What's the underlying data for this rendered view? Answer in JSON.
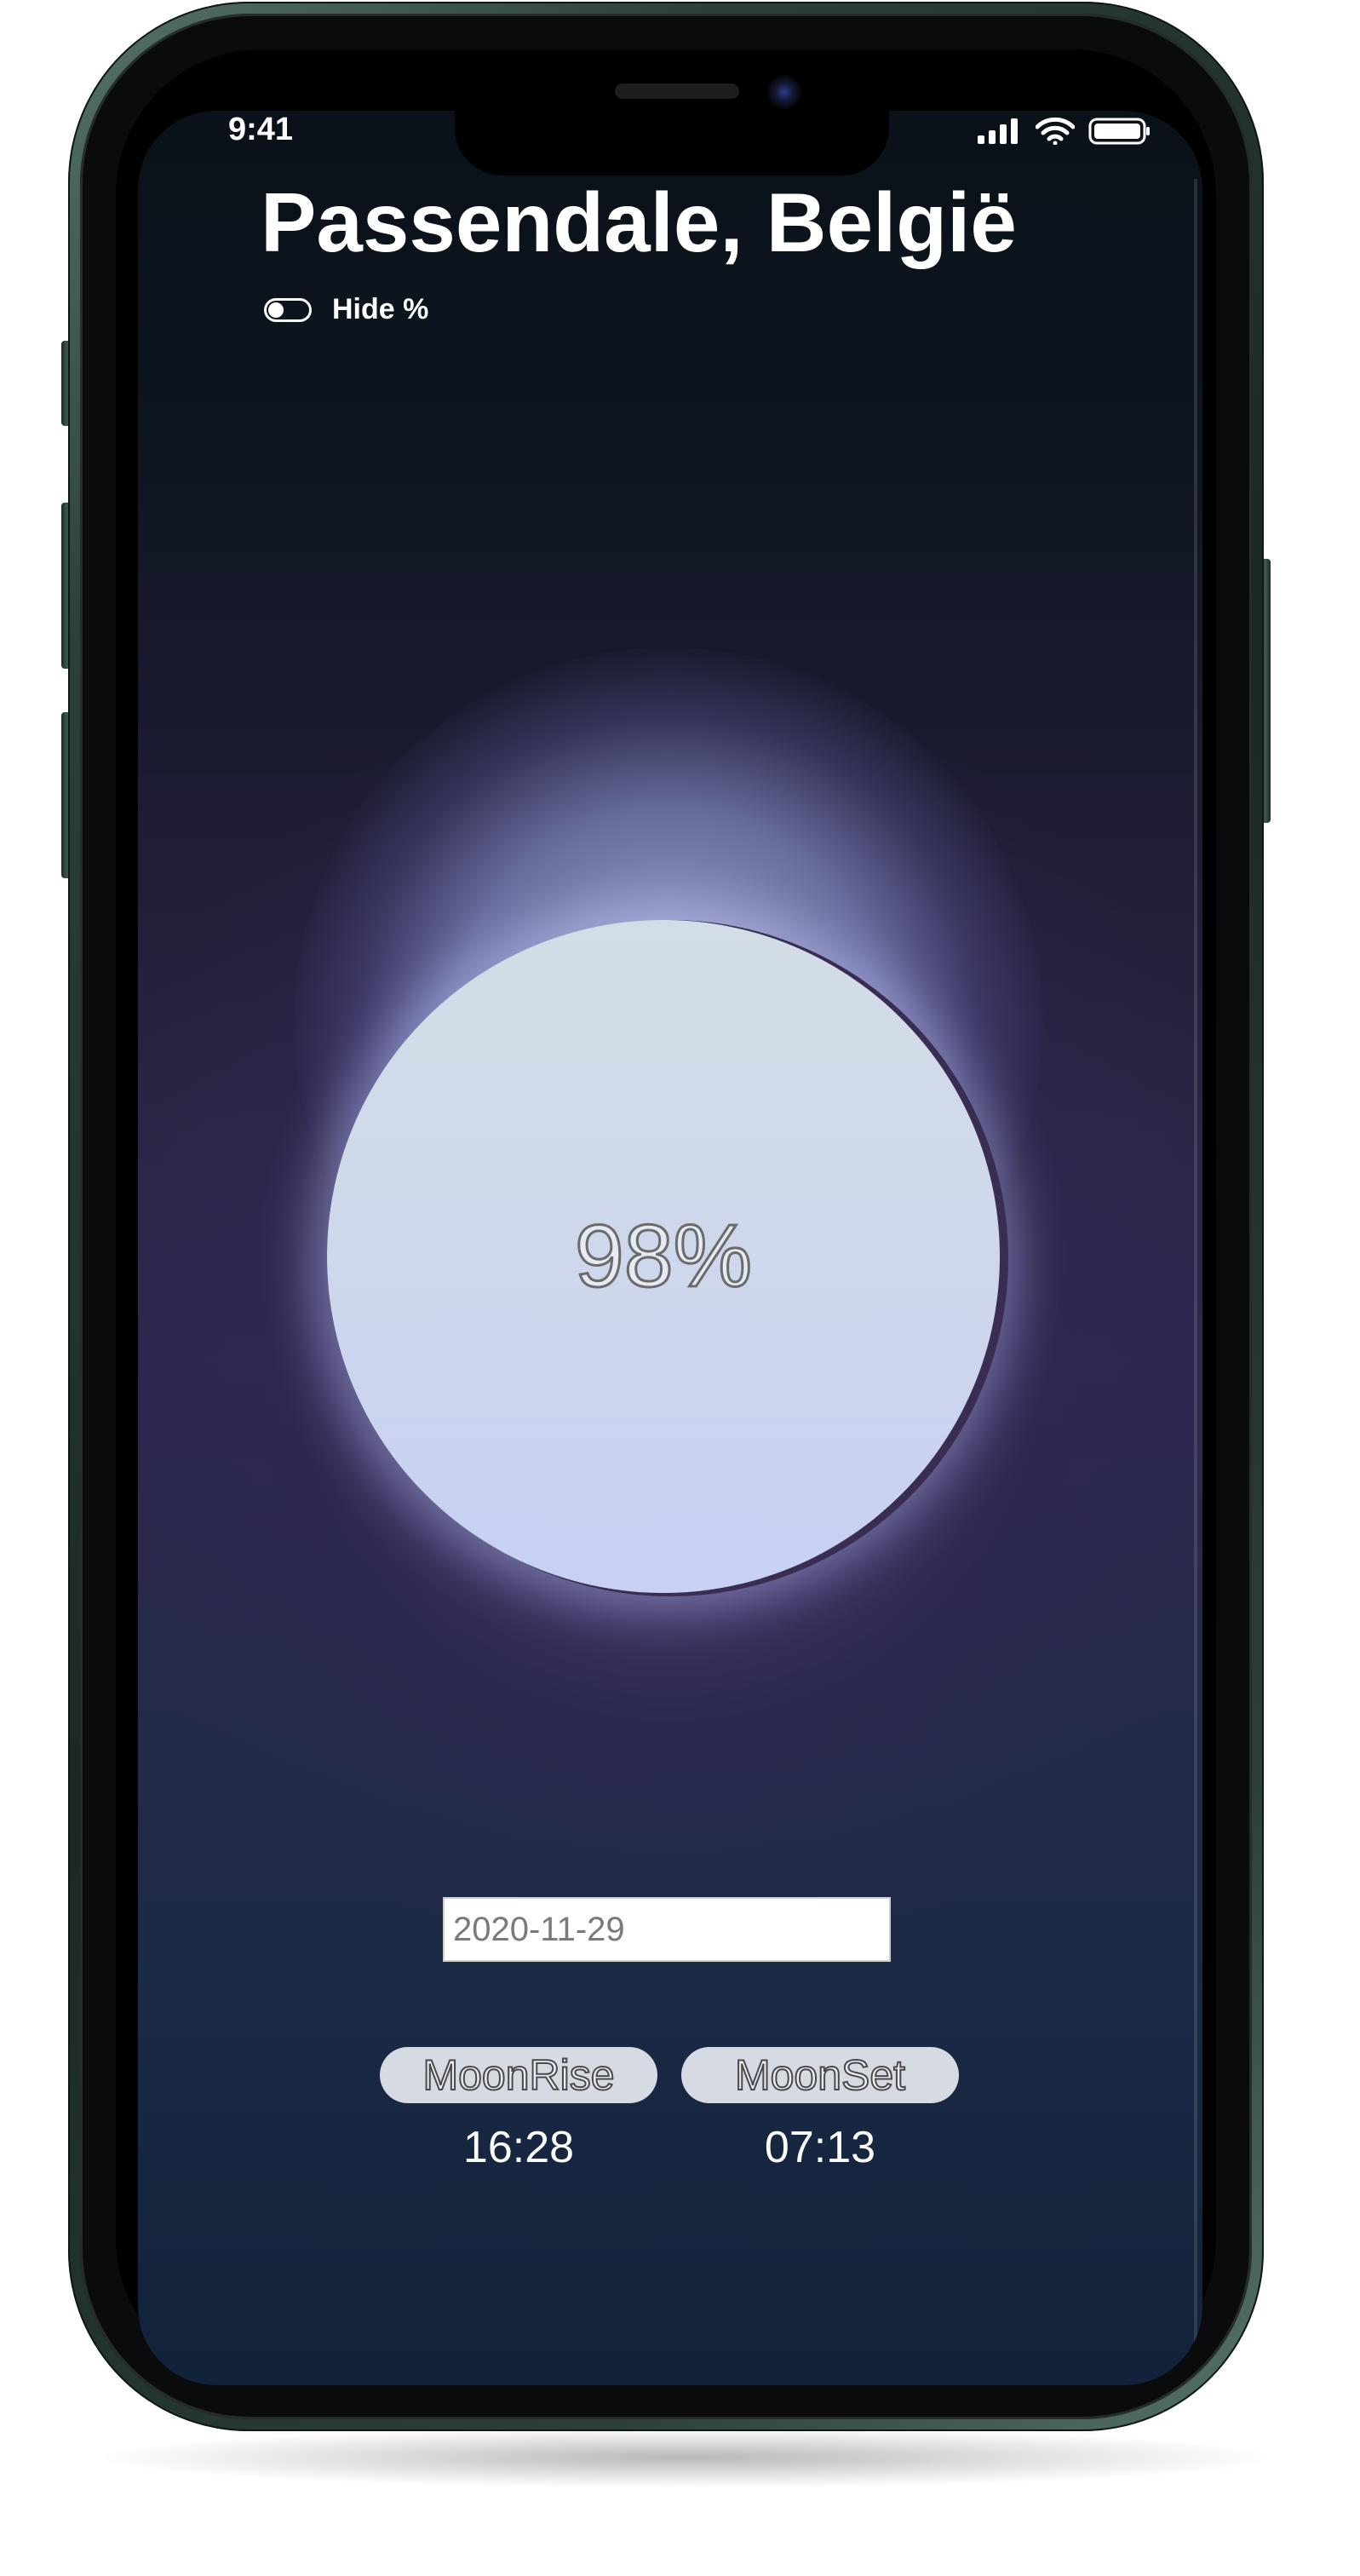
{
  "status_bar": {
    "time": "9:41",
    "icons": [
      "signal-icon",
      "wifi-icon",
      "battery-icon"
    ]
  },
  "header": {
    "title": "Passendale, België"
  },
  "toggle": {
    "label": "Hide %",
    "checked": false
  },
  "moon": {
    "illumination_text": "98%",
    "illumination_fraction": 0.98
  },
  "date_input": {
    "value": "2020-11-29"
  },
  "moon_times": {
    "rise_label": "MoonRise",
    "rise_time": "16:28",
    "set_label": "MoonSet",
    "set_time": "07:13"
  },
  "colors": {
    "background_top": "#0a1118",
    "background_glow": "#5a4a8a",
    "moon_light": "#d3dde6",
    "moon_lower": "#c8d0f4",
    "pill_bg": "#d6dae3",
    "phone_frame": "#2c3f39"
  }
}
